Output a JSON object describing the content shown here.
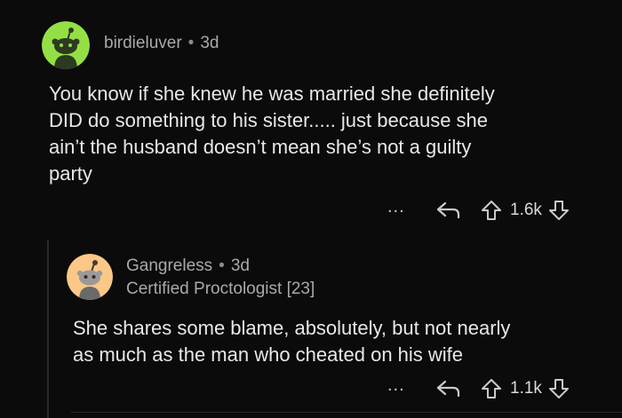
{
  "comments": [
    {
      "username": "birdieluver",
      "separator": "•",
      "age": "3d",
      "flair": "",
      "avatar_color": "#94e044",
      "body_lines": [
        "You know if she knew he was married she definitely",
        "DID do something to his sister..... just because she",
        "ain’t the husband doesn’t mean she’s not a guilty",
        "party"
      ],
      "actions": {
        "more_label": "...",
        "reply_icon": "reply-arrow-icon",
        "upvote_icon": "upvote-arrow-icon",
        "score": "1.6k",
        "downvote_icon": "downvote-arrow-icon"
      }
    },
    {
      "username": "Gangreless",
      "separator": "•",
      "age": "3d",
      "flair": "Certified Proctologist [23]",
      "avatar_color": "#fcc888",
      "body_lines": [
        "She shares some blame, absolutely, but not nearly",
        "as much as the man who cheated on his wife"
      ],
      "actions": {
        "more_label": "...",
        "reply_icon": "reply-arrow-icon",
        "upvote_icon": "upvote-arrow-icon",
        "score": "1.1k",
        "downvote_icon": "downvote-arrow-icon"
      }
    }
  ]
}
